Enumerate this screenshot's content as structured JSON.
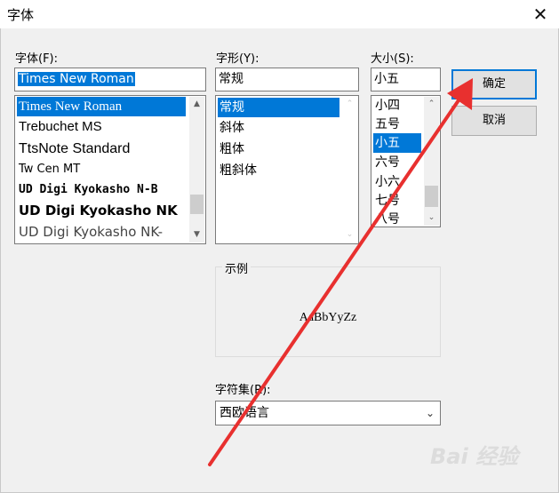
{
  "window": {
    "title": "字体",
    "close_glyph": "✕"
  },
  "font": {
    "label": "字体(F):",
    "value": "Times New Roman",
    "items": [
      {
        "label": "Times New Roman",
        "selected": true
      },
      {
        "label": "Trebuchet MS"
      },
      {
        "label": "TtsNote Standard"
      },
      {
        "label": "Tw Cen MT"
      },
      {
        "label": "UD Digi Kyokasho N-B"
      },
      {
        "label": "UD Digi Kyokasho NK"
      },
      {
        "label": "UD Digi Kyokasho NK-"
      }
    ]
  },
  "style": {
    "label": "字形(Y):",
    "value": "常规",
    "items": [
      {
        "label": "常规",
        "selected": true
      },
      {
        "label": "斜体"
      },
      {
        "label": "粗体"
      },
      {
        "label": "粗斜体"
      }
    ]
  },
  "size": {
    "label": "大小(S):",
    "value": "小五",
    "items": [
      {
        "label": "小四"
      },
      {
        "label": "五号"
      },
      {
        "label": "小五",
        "selected": true
      },
      {
        "label": "六号"
      },
      {
        "label": "小六"
      },
      {
        "label": "七号"
      },
      {
        "label": "八号"
      }
    ]
  },
  "buttons": {
    "ok": "确定",
    "cancel": "取消"
  },
  "sample": {
    "label": "示例",
    "text": "AaBbYyZz"
  },
  "charset": {
    "label": "字符集(R):",
    "value": "西欧语言"
  },
  "watermark": {
    "text": "Bai 经验"
  },
  "colors": {
    "selection": "#0078d7",
    "arrow": "#e8302f"
  }
}
